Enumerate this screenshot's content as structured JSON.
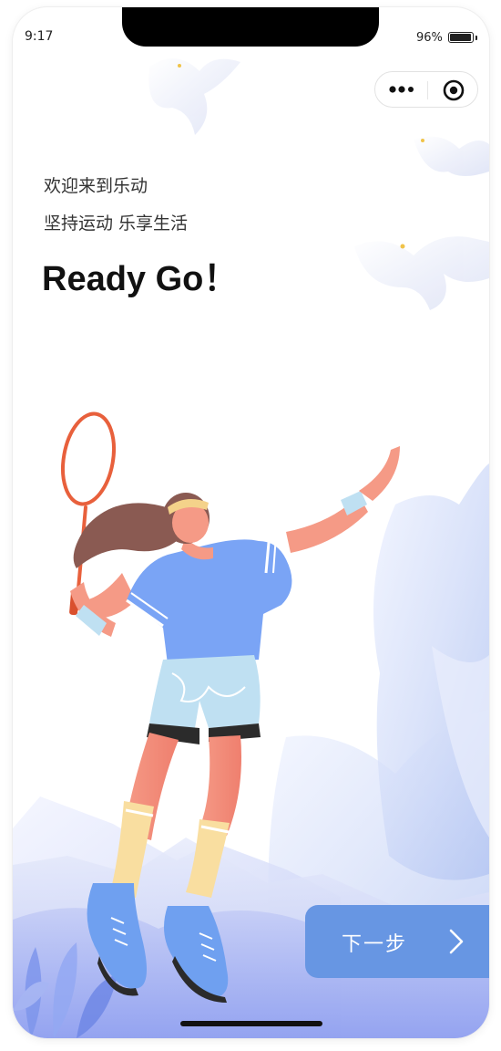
{
  "status_bar": {
    "time": "9:17",
    "battery_percent": "96%"
  },
  "capsule": {
    "more_icon": "more-dots-icon",
    "close_icon": "target-circle-icon"
  },
  "intro": {
    "greeting": "欢迎来到乐动",
    "slogan": "坚持运动 乐享生活",
    "headline": "Ready Go！"
  },
  "next_button": {
    "label": "下一步",
    "icon": "chevron-right-icon"
  },
  "illustration": {
    "subject": "badminton-player-illustration"
  },
  "colors": {
    "accent": "#6796e3",
    "shirt": "#7aa4f5",
    "racket": "#e8603c",
    "hair": "#8a5a52"
  }
}
